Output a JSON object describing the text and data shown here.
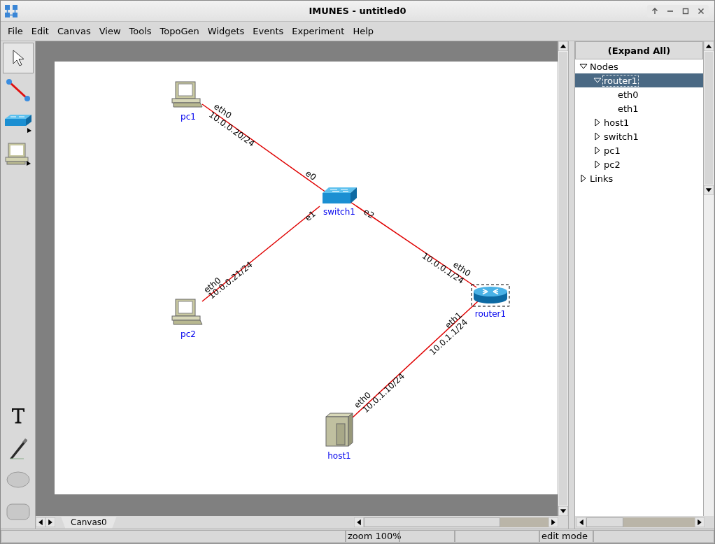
{
  "window": {
    "title": "IMUNES - untitled0"
  },
  "menu": [
    "File",
    "Edit",
    "Canvas",
    "View",
    "Tools",
    "TopoGen",
    "Widgets",
    "Events",
    "Experiment",
    "Help"
  ],
  "tools": [
    {
      "kind": "select",
      "selected": true
    },
    {
      "kind": "link",
      "selected": false
    },
    {
      "kind": "switch",
      "selected": false
    },
    {
      "kind": "pc",
      "selected": false
    },
    {
      "kind": "text",
      "selected": false
    },
    {
      "kind": "pen",
      "selected": false
    },
    {
      "kind": "oval",
      "selected": false
    },
    {
      "kind": "rectangle",
      "selected": false
    }
  ],
  "canvas": {
    "nodes": [
      {
        "name": "pc1",
        "kind": "pc",
        "selected": false
      },
      {
        "name": "switch1",
        "kind": "switch",
        "selected": false
      },
      {
        "name": "pc2",
        "kind": "pc",
        "selected": false
      },
      {
        "name": "router1",
        "kind": "router",
        "selected": true
      },
      {
        "name": "host1",
        "kind": "host",
        "selected": false
      }
    ],
    "links": [
      {
        "from": {
          "iface": "eth0",
          "address": "10.0.0.20/24"
        },
        "to": {
          "iface": "e0"
        }
      },
      {
        "from": {
          "iface": "eth0",
          "address": "10.0.0.21/24"
        },
        "to": {
          "iface": "e1"
        }
      },
      {
        "from": {
          "iface": "e2"
        },
        "to": {
          "iface": "eth0",
          "address": "10.0.0.1/24"
        }
      },
      {
        "from": {
          "iface": "eth0",
          "address": "10.0.1.10/24"
        },
        "to": {
          "iface": "eth1",
          "address": "10.0.1.1/24"
        }
      }
    ]
  },
  "tabs": [
    {
      "label": "Canvas0",
      "selected": true
    }
  ],
  "tree": {
    "button": "(Expand All)",
    "items": [
      {
        "label": "Nodes",
        "expanded": true,
        "selected": false,
        "children": [
          {
            "label": "router1",
            "expanded": true,
            "selected": true,
            "children": [
              {
                "label": "eth0",
                "selected": false
              },
              {
                "label": "eth1",
                "selected": false
              }
            ]
          },
          {
            "label": "host1",
            "expanded": false,
            "selected": false
          },
          {
            "label": "switch1",
            "expanded": false,
            "selected": false
          },
          {
            "label": "pc1",
            "expanded": false,
            "selected": false
          },
          {
            "label": "pc2",
            "expanded": false,
            "selected": false
          }
        ]
      },
      {
        "label": "Links",
        "expanded": false,
        "selected": false
      }
    ]
  },
  "status_bar": {
    "zoom": "zoom 100%",
    "mode": "edit mode"
  }
}
